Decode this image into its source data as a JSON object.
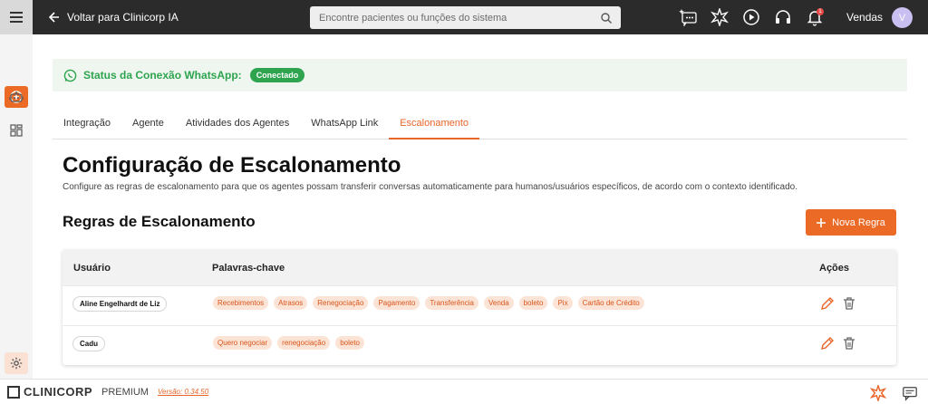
{
  "header": {
    "back_label": "Voltar para Clinicorp IA",
    "search_placeholder": "Encontre pacientes ou funções do sistema",
    "notification_count": "1",
    "user_name": "Vendas",
    "avatar_initial": "V"
  },
  "status": {
    "label": "Status da Conexão WhatsApp:",
    "badge": "Conectado"
  },
  "tabs": [
    {
      "label": "Integração"
    },
    {
      "label": "Agente"
    },
    {
      "label": "Atividades dos Agentes"
    },
    {
      "label": "WhatsApp Link"
    },
    {
      "label": "Escalonamento"
    }
  ],
  "active_tab": "Escalonamento",
  "page": {
    "title": "Configuração de Escalonamento",
    "description": "Configure as regras de escalonamento para que os agentes possam transferir conversas automaticamente para humanos/usuários específicos, de acordo com o contexto identificado.",
    "section_title": "Regras de Escalonamento",
    "new_rule_label": "Nova Regra"
  },
  "table": {
    "columns": [
      "Usuário",
      "Palavras-chave",
      "Ações"
    ],
    "rows": [
      {
        "user": "Aline Engelhardt de Liz",
        "keywords": [
          "Recebimentos",
          "Atrasos",
          "Renegociação",
          "Pagamento",
          "Transferência",
          "Venda",
          "boleto",
          "Pix",
          "Cartão de Crédito"
        ]
      },
      {
        "user": "Cadu",
        "keywords": [
          "Quero negociar",
          "renegociação",
          "boleto"
        ]
      }
    ]
  },
  "footer": {
    "brand": "CLINICORP",
    "plan": "PREMIUM",
    "version": "Versão: 0.34.50"
  },
  "colors": {
    "accent": "#ea6a26",
    "success": "#2ea44f",
    "topbar": "#2b2b2b"
  }
}
